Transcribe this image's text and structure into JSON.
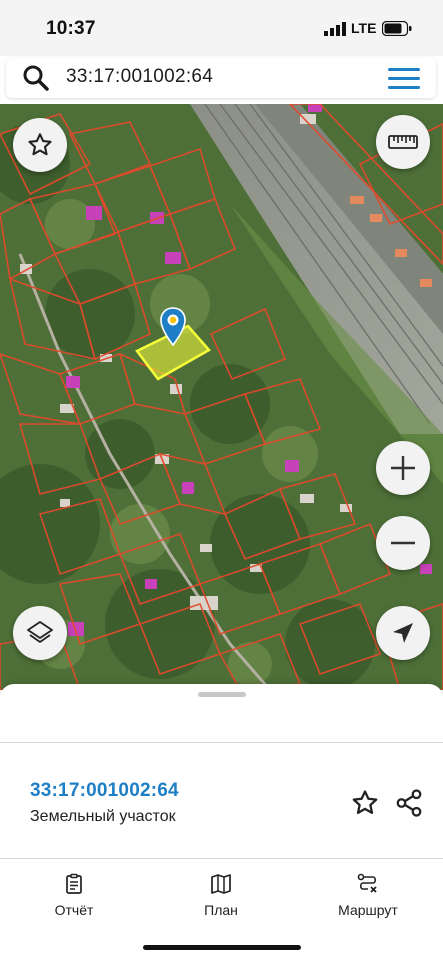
{
  "status_bar": {
    "time": "10:37",
    "network": "LTE"
  },
  "search": {
    "query": "33:17:001002:64"
  },
  "map": {
    "parcel_highlight_color": "#f6ff3a",
    "parcel_border_color": "#e24a2c",
    "pin_color": "#1e7fc6",
    "controls": {
      "favorite_icon": "star-outline-icon",
      "ruler_icon": "ruler-icon",
      "zoom_in_icon": "plus-icon",
      "zoom_out_icon": "minus-icon",
      "layers_icon": "layers-icon",
      "locate_icon": "navigation-arrow-icon"
    }
  },
  "sheet": {
    "cadastral_number": "33:17:001002:64",
    "object_type": "Земельный участок"
  },
  "tabs": [
    {
      "label": "Отчёт",
      "icon": "report-icon"
    },
    {
      "label": "План",
      "icon": "map-icon"
    },
    {
      "label": "Маршрут",
      "icon": "route-icon"
    }
  ]
}
